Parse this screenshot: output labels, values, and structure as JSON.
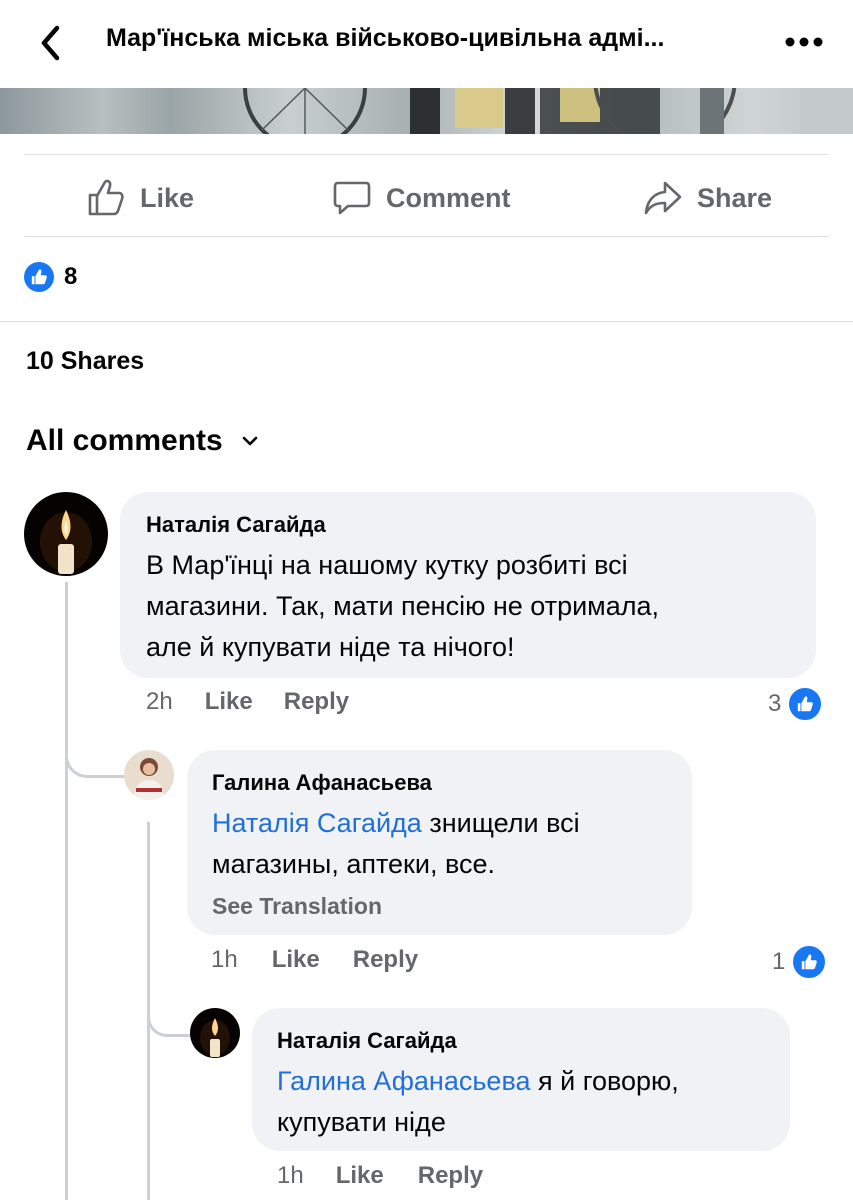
{
  "header": {
    "title": "Мар'їнська міська військово-цивільна адмі...",
    "back_icon": "chevron-left-icon",
    "more_icon": "more-dots-icon"
  },
  "actions": {
    "like": "Like",
    "comment": "Comment",
    "share": "Share"
  },
  "reactions": {
    "count": "8"
  },
  "shares_text": "10 Shares",
  "comments_header": "All comments",
  "comments": [
    {
      "author": "Наталія Сагайда",
      "lines": [
        "В Мар'їнці на нашому кутку розбиті всі",
        "магазини. Так, мати пенсію не отримала,",
        "але й купувати ніде та нічого!"
      ],
      "time": "2h",
      "like": "Like",
      "reply": "Reply",
      "reaction_count": "3"
    },
    {
      "author": "Галина Афанасьева",
      "mention": "Наталія Сагайда",
      "line1_rest": " знищели всі",
      "line2": "магазины, аптеки, все.",
      "see_translation": "See Translation",
      "time": "1h",
      "like": "Like",
      "reply": "Reply",
      "reaction_count": "1"
    },
    {
      "author": "Наталія Сагайда",
      "mention": "Галина Афанасьева",
      "line1_rest": " я й говорю,",
      "line2": "купувати ніде",
      "time": "1h",
      "like": "Like",
      "reply": "Reply"
    }
  ],
  "colors": {
    "accent": "#1877f2",
    "mention": "#216fdb",
    "bubble": "#f0f2f5",
    "secondary_text": "#65676b"
  }
}
